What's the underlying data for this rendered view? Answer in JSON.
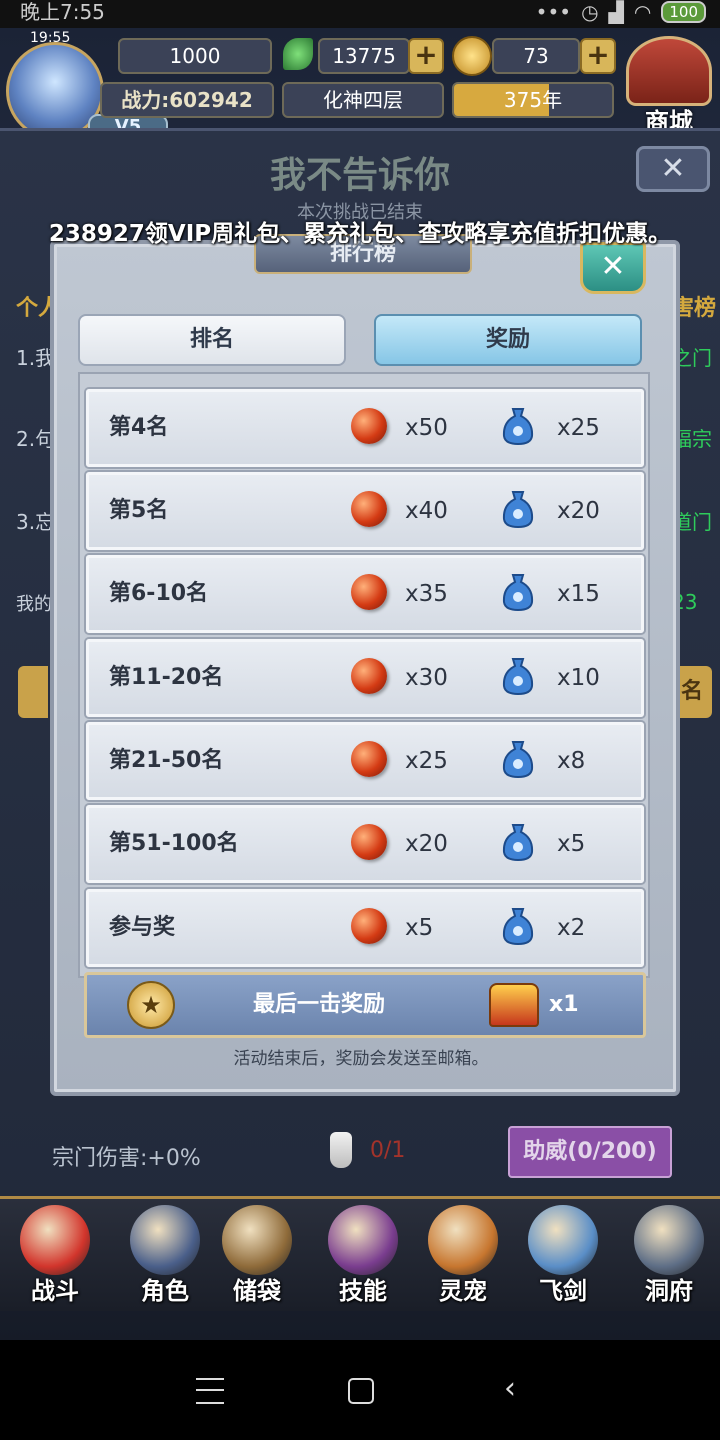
{
  "status_bar": {
    "time": "晚上7:55",
    "battery": "100"
  },
  "hud": {
    "clock": "19:55",
    "vip": "V5",
    "resource_1": "1000",
    "jade": "13775",
    "coins": "73",
    "power": "战力:602942",
    "realm": "化神四层",
    "years": "375年",
    "shop": "商城"
  },
  "background_panel": {
    "title": "我不告诉你",
    "subtitle": "本次挑战已结束",
    "left_tab_partial": "个人",
    "right_tab_partial": "害榜",
    "rows_left": [
      "1.我",
      "2.句",
      "3.忘",
      "我的"
    ],
    "rows_right": [
      "之门",
      "福宗",
      "道门",
      "23"
    ],
    "button_partial": "名",
    "sect_damage": "宗门伤害:+0%",
    "flask_count": "0/1",
    "cheer_button": "助威(0/200)"
  },
  "marquee": "238927领VIP周礼包、累充礼包、查攻略享充值折扣优惠。",
  "modal": {
    "title": "排行榜",
    "tabs": {
      "ranking": "排名",
      "reward": "奖励"
    },
    "active_tab": "reward",
    "rewards": [
      {
        "rank": "第4名",
        "orb_qty": "x50",
        "bag_qty": "x25"
      },
      {
        "rank": "第5名",
        "orb_qty": "x40",
        "bag_qty": "x20"
      },
      {
        "rank": "第6-10名",
        "orb_qty": "x35",
        "bag_qty": "x15"
      },
      {
        "rank": "第11-20名",
        "orb_qty": "x30",
        "bag_qty": "x10"
      },
      {
        "rank": "第21-50名",
        "orb_qty": "x25",
        "bag_qty": "x8"
      },
      {
        "rank": "第51-100名",
        "orb_qty": "x20",
        "bag_qty": "x5"
      },
      {
        "rank": "参与奖",
        "orb_qty": "x5",
        "bag_qty": "x2"
      }
    ],
    "last_hit": {
      "label": "最后一击奖励",
      "qty": "x1"
    },
    "note": "活动结束后，奖励会发送至邮箱。"
  },
  "bottom_nav": [
    "战斗",
    "角色",
    "储袋",
    "技能",
    "灵宠",
    "飞剑",
    "洞府"
  ],
  "colors": {
    "active_tab": "#9fd4ef",
    "modal_bg": "#b7c0cc",
    "accent_gold": "#d8b65a",
    "cheer_purple": "#8a4fa6"
  }
}
